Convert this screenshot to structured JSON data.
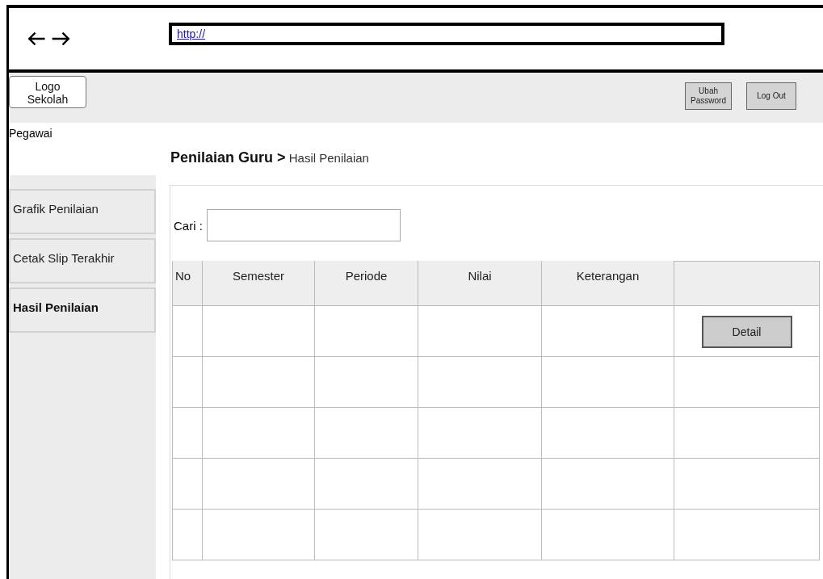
{
  "browser": {
    "address": "http://"
  },
  "header": {
    "logo": "Logo\nSekolah",
    "buttons": [
      "Ubah\nPassword",
      "Log Out"
    ]
  },
  "sidebar": {
    "title": "Pegawai",
    "items": [
      {
        "label": "Grafik Penilaian",
        "selected": false
      },
      {
        "label": "Cetak Slip Terakhir",
        "selected": false
      },
      {
        "label": "Hasil Penilaian",
        "selected": true
      }
    ]
  },
  "breadcrumb": "**Penilaian Guru >** Hasil Penilaian",
  "search": {
    "label": "Cari :"
  },
  "table": {
    "columns": [
      "No",
      "Semester",
      "Periode",
      "Nilai",
      "Keterangan"
    ],
    "rows": [
      {
        "kind": "action",
        "button": "Detail"
      },
      {
        "kind": "empty"
      },
      {
        "kind": "empty"
      },
      {
        "kind": "empty"
      },
      {
        "kind": "empty"
      }
    ]
  }
}
